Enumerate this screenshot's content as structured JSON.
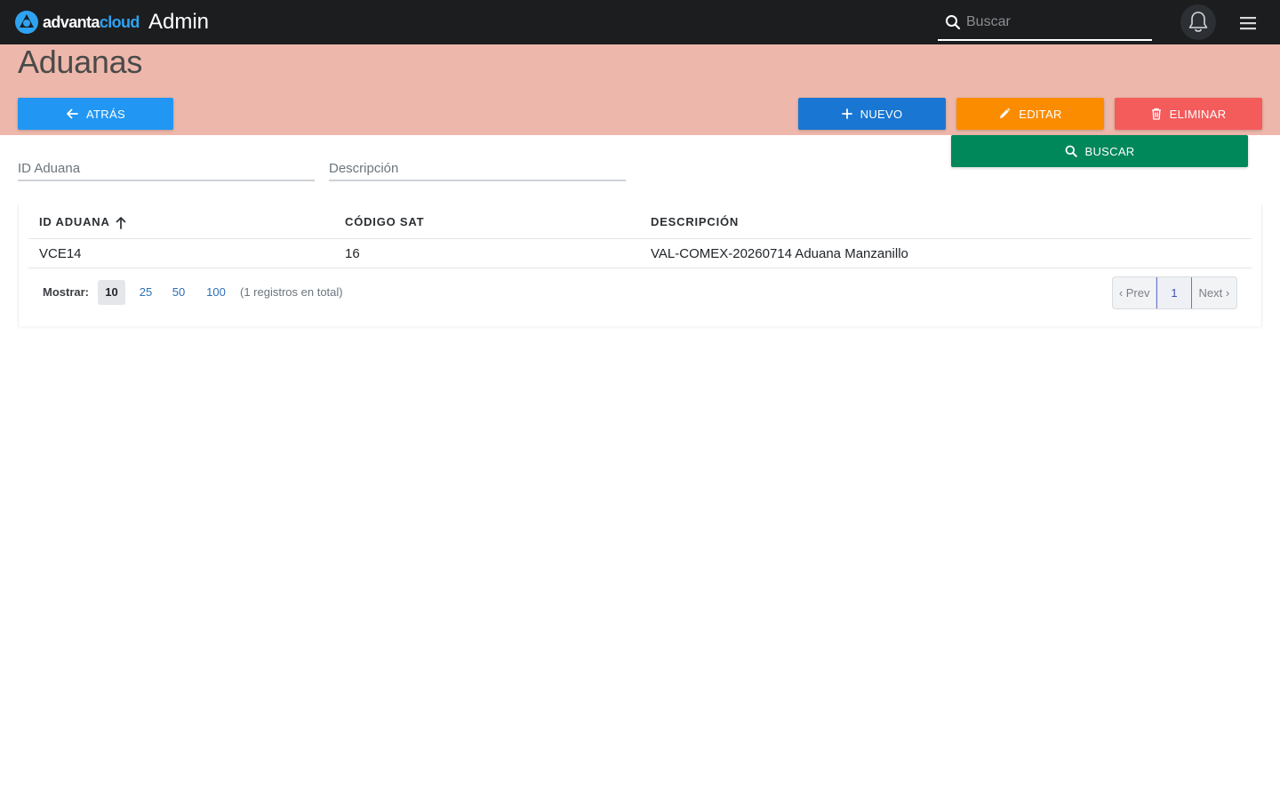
{
  "topbar": {
    "brand_part1": "advanta",
    "brand_part2": "cloud",
    "app_title": "Admin",
    "search_placeholder": "Buscar",
    "brand_color": "#2ea3f2",
    "icons": [
      "logo-icon",
      "search-icon",
      "bell-icon",
      "menu-icon"
    ]
  },
  "page": {
    "title": "Aduanas",
    "header_color": "#edb8ab"
  },
  "actions": {
    "back_label": "ATRÁS",
    "new_label": "NUEVO",
    "edit_label": "EDITAR",
    "delete_label": "ELIMINAR",
    "search_label": "BUSCAR",
    "colors": {
      "back": "#2196f3",
      "new": "#1976d2",
      "edit": "#fb8c00",
      "delete": "#f45b5b",
      "search": "#00875a"
    }
  },
  "filters": {
    "id_placeholder": "ID Aduana",
    "desc_placeholder": "Descripción",
    "id_value": "",
    "desc_value": ""
  },
  "table": {
    "columns": [
      "ID ADUANA",
      "CÓDIGO SAT",
      "DESCRIPCIÓN"
    ],
    "sort_column": "ID ADUANA",
    "sort_direction": "asc",
    "rows": [
      [
        "VCE14",
        "16",
        "VAL-COMEX-20260714 Aduana Manzanillo"
      ]
    ]
  },
  "footer": {
    "show_label": "Mostrar:",
    "page_sizes": [
      "10",
      "25",
      "50",
      "100"
    ],
    "selected_page_size": "10",
    "total_text": "(1 registros en total)",
    "prev_label": "‹ Prev",
    "current_page": "1",
    "next_label": "Next ›"
  }
}
